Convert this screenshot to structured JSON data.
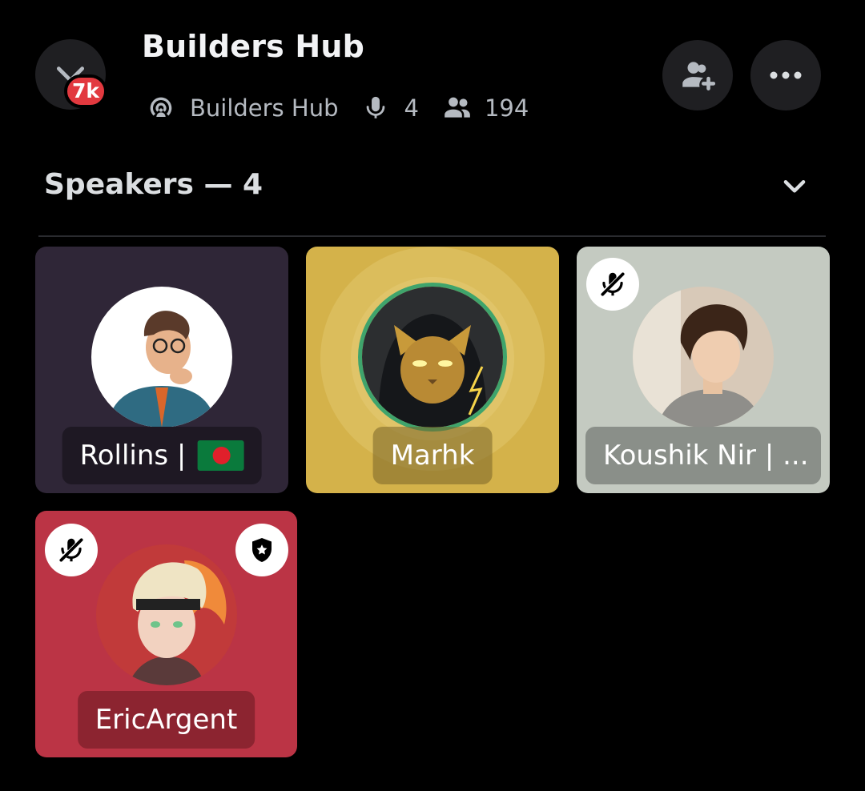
{
  "header": {
    "title": "Builders Hub",
    "back_badge": "7k",
    "stage_name": "Builders Hub",
    "speaker_count": "4",
    "listener_count": "194",
    "icons": {
      "back": "chevron-down-icon",
      "invite": "add-user-icon",
      "more": "more-horizontal-icon",
      "stage": "stage-channel-icon",
      "mic": "microphone-icon",
      "people": "people-icon"
    }
  },
  "section": {
    "heading": "Speakers — 4",
    "collapse_icon": "chevron-down-icon"
  },
  "speakers": [
    {
      "name": "Rollins | ",
      "flag": "Bangladesh flag",
      "muted": false,
      "moderator": false,
      "speaking": false,
      "tile_color": "#2f2637"
    },
    {
      "name": "Marhk",
      "muted": false,
      "moderator": false,
      "speaking": true,
      "tile_color": "#d4b24a"
    },
    {
      "name": "Koushik Nir | ...",
      "muted": true,
      "moderator": false,
      "speaking": false,
      "tile_color": "#c4cac1"
    },
    {
      "name": "EricArgent",
      "muted": true,
      "moderator": true,
      "speaking": false,
      "tile_color": "#bb3445"
    }
  ],
  "colors": {
    "background": "#000000",
    "badge": "#e2393f",
    "speaking_ring": "#3fa46c"
  }
}
